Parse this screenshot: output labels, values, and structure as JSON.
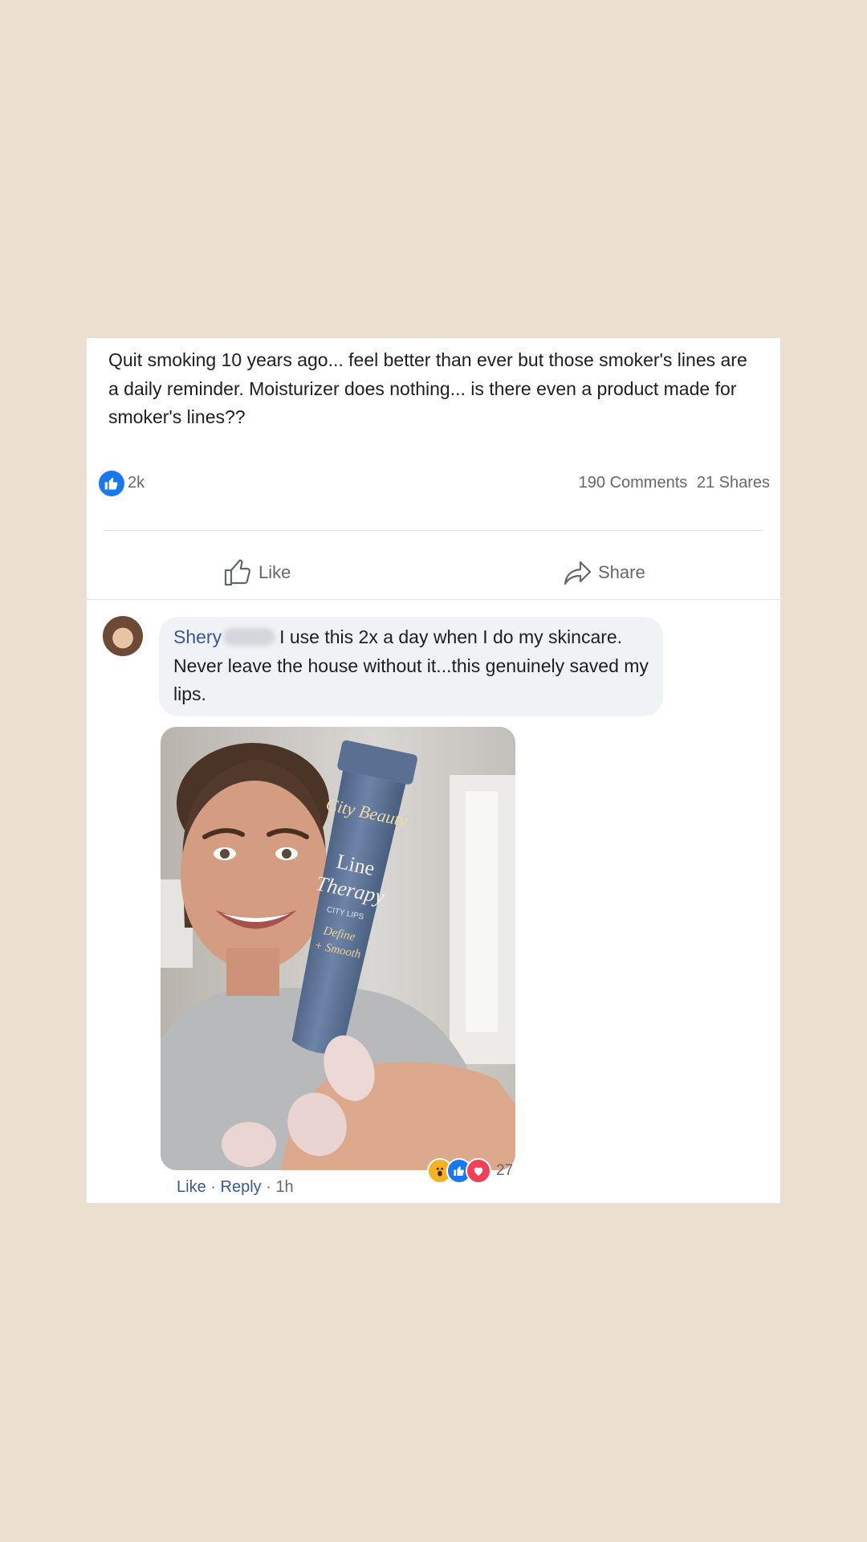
{
  "post": {
    "text": "Quit smoking 10 years ago... feel better than ever but those smoker's lines are a daily reminder. Moisturizer does nothing... is there even a product made for smoker's lines??",
    "like_count": "2k",
    "comments_label": "190 Comments",
    "shares_label": "21 Shares"
  },
  "actions": {
    "like_label": "Like",
    "share_label": "Share"
  },
  "comment": {
    "author": "Shery",
    "text": "I use this 2x a day when I do my skincare. Never leave the house without it...this genuinely saved my lips.",
    "reaction_count": "27",
    "like_label": "Like",
    "reply_label": "Reply",
    "time": "1h"
  },
  "product": {
    "brand": "City Beauty",
    "name_line1": "Line",
    "name_line2": "Therapy",
    "sub": "CITY LIPS",
    "tagline1": "Define",
    "tagline2": "+ Smooth"
  },
  "colors": {
    "page_background": "#ebdfcf",
    "facebook_blue": "#1877f2",
    "link_blue": "#385898",
    "tube_blue": "#5f7799"
  },
  "icons": {
    "like_badge": "thumbs-up-icon",
    "like_action": "thumbs-up-outline-icon",
    "share_action": "share-arrow-icon",
    "reactions": [
      "wow-icon",
      "like-icon",
      "love-icon"
    ]
  }
}
